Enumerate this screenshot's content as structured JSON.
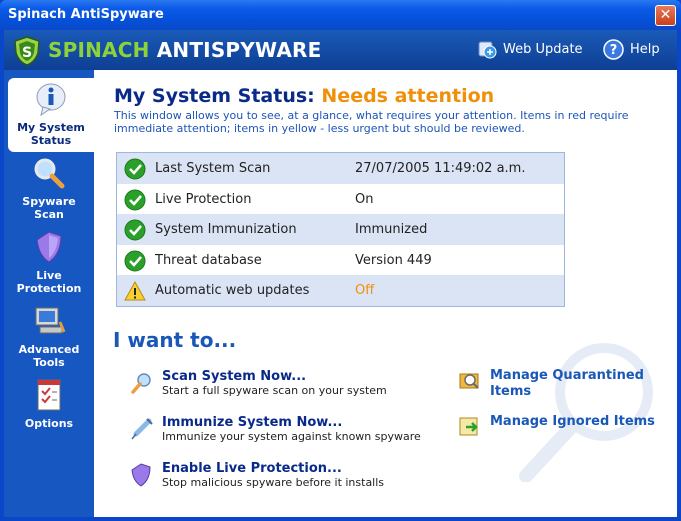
{
  "window": {
    "title": "Spinach AntiSpyware",
    "close": "✕"
  },
  "header": {
    "brand_part1": "SPINACH",
    "brand_part2": "ANTISPYWARE",
    "web_update": "Web Update",
    "help": "Help"
  },
  "sidebar": {
    "items": [
      {
        "label1": "My System",
        "label2": "Status",
        "icon": "info-icon",
        "active": true
      },
      {
        "label1": "Spyware",
        "label2": "Scan",
        "icon": "magnifier-icon",
        "active": false
      },
      {
        "label1": "Live",
        "label2": "Protection",
        "icon": "shield-icon",
        "active": false
      },
      {
        "label1": "Advanced",
        "label2": "Tools",
        "icon": "computer-icon",
        "active": false
      },
      {
        "label1": "Options",
        "label2": "",
        "icon": "checklist-icon",
        "active": false
      }
    ]
  },
  "status": {
    "title_prefix": "My System Status:",
    "title_state": "Needs attention",
    "description": "This window allows you to see, at a glance, what requires your attention.  Items in red require immediate attention; items in yellow - less urgent but should be reviewed.",
    "rows": [
      {
        "label": "Last System Scan",
        "value": "27/07/2005 11:49:02 a.m.",
        "state": "ok"
      },
      {
        "label": "Live Protection",
        "value": "On",
        "state": "ok"
      },
      {
        "label": "System Immunization",
        "value": "Immunized",
        "state": "ok"
      },
      {
        "label": "Threat database",
        "value": "Version 449",
        "state": "ok"
      },
      {
        "label": "Automatic web updates",
        "value": "Off",
        "state": "warning"
      }
    ]
  },
  "actions": {
    "heading": "I want to...",
    "items": [
      {
        "title": "Scan System Now...",
        "desc": "Start a full spyware scan on your system",
        "icon": "magnifier-icon"
      },
      {
        "title": "Immunize System Now...",
        "desc": "Immunize your system against known spyware",
        "icon": "syringe-icon"
      },
      {
        "title": "Enable Live Protection...",
        "desc": "Stop malicious spyware before it installs",
        "icon": "shield-icon"
      }
    ],
    "right": [
      {
        "title1": "Manage Quarantined",
        "title2": "Items",
        "icon": "quarantine-icon"
      },
      {
        "title1": "Manage Ignored Items",
        "title2": "",
        "icon": "ignored-items-icon"
      }
    ]
  },
  "colors": {
    "accent": "#f0900a",
    "sidebar": "#1657c2",
    "ok": "#2aa02a",
    "warning": "#f0c020"
  }
}
